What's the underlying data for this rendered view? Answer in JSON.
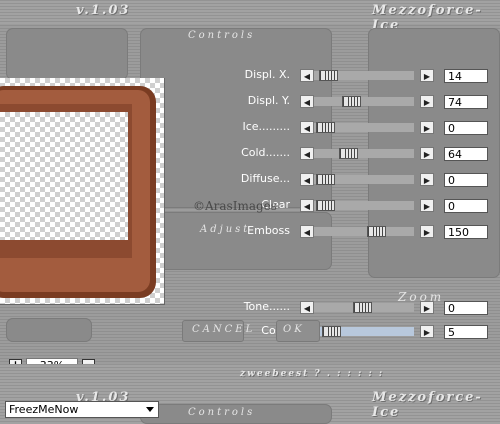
{
  "app": {
    "version": "v.1.03",
    "brand": "Mezzoforce-Ice",
    "accent": "#b8c8dc"
  },
  "sections": {
    "controls": "Controls",
    "adjust": "Adjust",
    "zoom": "Zoom"
  },
  "watermark": "©ArasImages",
  "params": [
    {
      "label": "Displ. X.",
      "value": "14",
      "level": 0.04
    },
    {
      "label": "Displ. Y.",
      "value": "74",
      "level": 0.33
    },
    {
      "label": "Ice.........",
      "value": "0",
      "level": 0.0
    },
    {
      "label": "Cold.......",
      "value": "64",
      "level": 0.29
    },
    {
      "label": "Diffuse...",
      "value": "0",
      "level": 0.0
    },
    {
      "label": "Clear",
      "value": "0",
      "level": 0.0
    },
    {
      "label": "Emboss",
      "value": "150",
      "level": 0.66
    },
    {
      "label": "Tone......",
      "value": "0",
      "level": 0.47
    },
    {
      "label": "Color",
      "value": "5",
      "level": 0.08
    }
  ],
  "buttons": {
    "cancel": "CANCEL",
    "ok": "OK"
  },
  "zoom": {
    "plus": "+",
    "minus": "−",
    "value": "33%"
  },
  "footer": {
    "text": "zweebeest ? . : : : : :"
  },
  "preset": {
    "selected": "FreezMeNow"
  },
  "icons": {
    "left": "triangle-left",
    "right": "triangle-right",
    "dropdown": "triangle-down"
  }
}
